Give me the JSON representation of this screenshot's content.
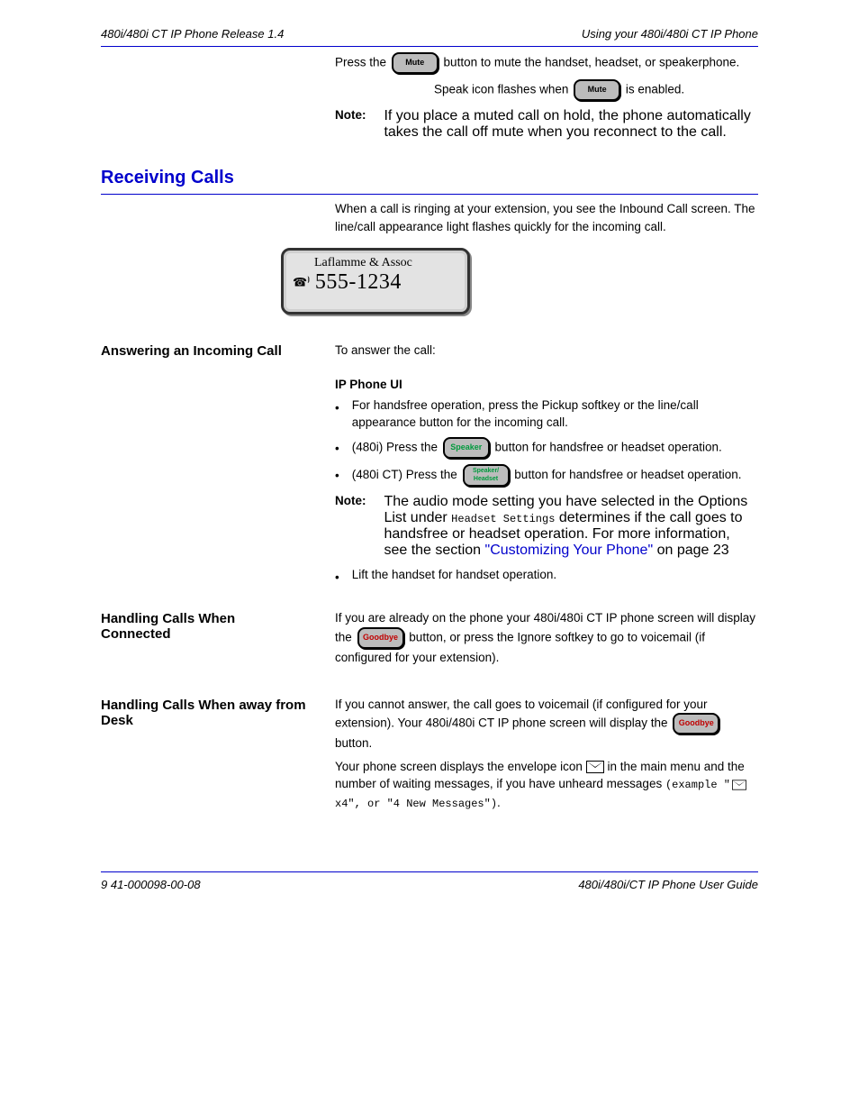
{
  "header": {
    "left": "480i/480i CT IP Phone Release 1.4",
    "right": "Using your 480i/480i CT IP Phone"
  },
  "footer": {
    "left": "9 41-000098-00-08",
    "right": "480i/480i/CT IP Phone User Guide"
  },
  "mute_section": {
    "p1_pre": "Press the ",
    "btn1": "Mute",
    "p1_post": " button to mute the handset, headset, or speakerphone.",
    "p2_pre": "Speak icon flashes when ",
    "btn2": "Mute",
    "p2_post": " is enabled.",
    "note_label": "Note:",
    "note_text": "If you place a muted call on hold, the phone automatically takes the call off mute when you reconnect to the call."
  },
  "receiving": {
    "title": "Receiving Calls",
    "p1": "When a call is ringing at your extension, you see the Inbound Call screen. The line/call appearance light flashes quickly for the incoming call.",
    "lcd_line1": "Laflamme & Assoc",
    "lcd_line2": "555-1234"
  },
  "answering": {
    "left_heading": "Answering an Incoming Call",
    "intro": "To answer the call:",
    "sub": "IP Phone UI",
    "bullets": {
      "b1": "For handsfree operation, press the Pickup softkey or the line/call appearance button for the incoming call.",
      "b2_pre": "(480i) Press the ",
      "b2_btn": "Speaker",
      "b2_post": " button for handsfree or headset operation.",
      "b3_pre": "(480i CT) Press the ",
      "b3_btn": "Speaker/\nHeadset",
      "b3_post": " button for handsfree or headset operation."
    },
    "note_label": "Note:",
    "note_pre": "The audio mode setting you have selected in the Options List under ",
    "note_code": "Headset Settings",
    "note_post": " determines if the call goes to handsfree or headset operation. For more information, see the section ",
    "note_link": "\"Customizing Your Phone\"",
    "note_tail": " on page 23",
    "b4": "Lift the handset for handset operation."
  },
  "connected": {
    "left_heading": "Handling Calls When Connected",
    "p_pre": "If you are already on the phone your 480i/480i CT IP phone screen will display the ",
    "p_btn": "Goodbye",
    "p_post": " button, or press the Ignore softkey to go to voicemail (if configured for your extension)."
  },
  "away": {
    "left_heading": "Handling Calls When away from Desk",
    "p_pre": "If you cannot answer, the call goes to voicemail (if configured for your extension). Your 480i/480i CT IP phone screen will display the ",
    "p_btn": "Goodbye",
    "p_post": " button.",
    "p2_pre": "Your phone screen displays the envelope icon ",
    "p2_post": " in the main menu and the number of waiting messages, if you have unheard messages ",
    "p2_example": " x4\", or \"4 New Messages\"",
    "p2_tail": "."
  }
}
